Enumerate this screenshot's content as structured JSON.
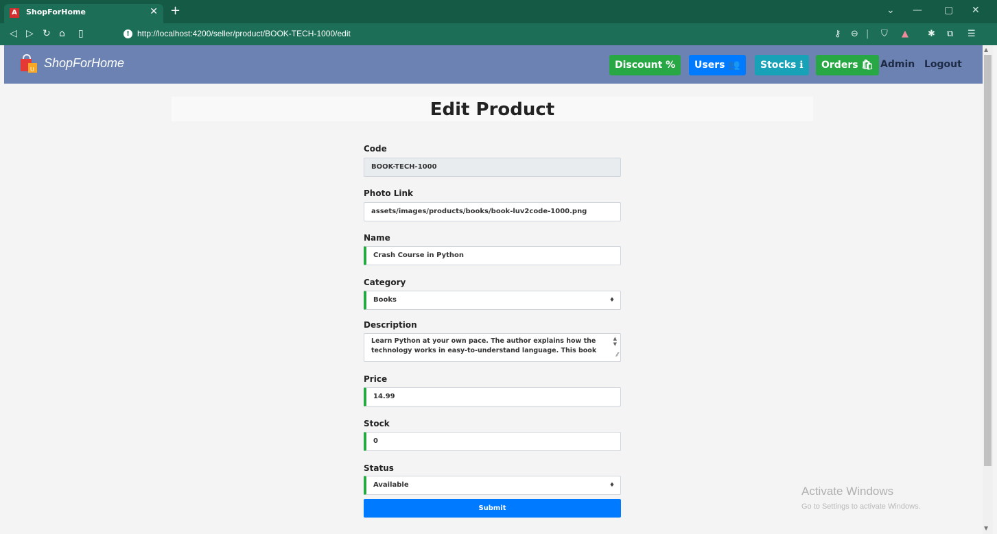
{
  "browser": {
    "tab_icon": "A",
    "tab_title": "ShopForHome",
    "url": "http://localhost:4200/seller/product/BOOK-TECH-1000/edit",
    "icons": [
      "back-icon",
      "forward-icon",
      "reload-icon",
      "home-icon",
      "bookmark-icon",
      "info-icon",
      "key-icon",
      "zoom-icon",
      "brave-shield-icon",
      "rewards-icon",
      "extensions-icon",
      "wallet-icon",
      "menu-icon"
    ]
  },
  "navbar": {
    "brand": "ShopForHome",
    "discount": "Discount %",
    "users": "Users 👥",
    "stocks": "Stocks ℹ",
    "orders": "Orders 🛍",
    "admin": "Admin",
    "logout": "Logout",
    "colors": {
      "bar": "#6b82b2",
      "discount": "#28a745",
      "users": "#007bff",
      "stocks": "#17a2b8",
      "orders": "#28a745"
    }
  },
  "page": {
    "title": "Edit Product"
  },
  "form": {
    "code": {
      "label": "Code",
      "value": "BOOK-TECH-1000"
    },
    "photo": {
      "label": "Photo Link",
      "value": "assets/images/products/books/book-luv2code-1000.png"
    },
    "name": {
      "label": "Name",
      "value": "Crash Course in Python"
    },
    "category": {
      "label": "Category",
      "value": "Books"
    },
    "description": {
      "label": "Description",
      "value": "Learn Python at your own pace. The author explains how the technology works in easy-to-understand language. This book"
    },
    "price": {
      "label": "Price",
      "value": "14.99"
    },
    "stock": {
      "label": "Stock",
      "value": "0"
    },
    "status": {
      "label": "Status",
      "value": "Available"
    },
    "submit": "Submit"
  },
  "watermark": {
    "title": "Activate Windows",
    "sub": "Go to Settings to activate Windows."
  }
}
